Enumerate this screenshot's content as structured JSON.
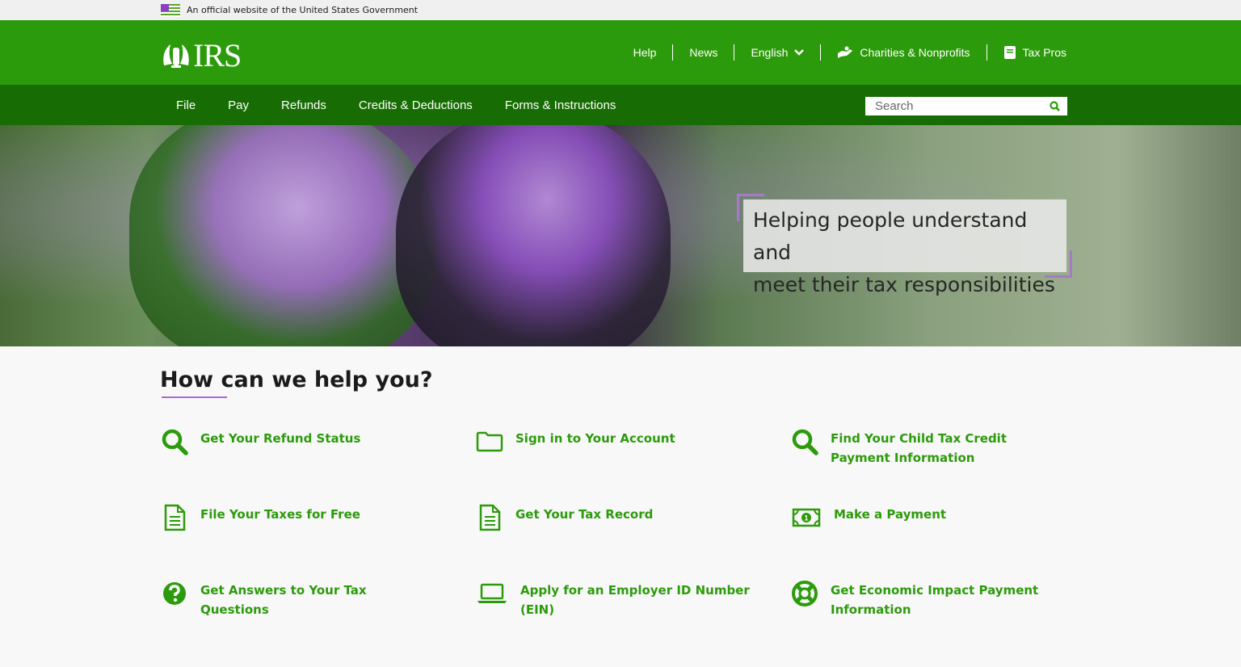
{
  "gov_banner": {
    "text": "An official website of the United States Government"
  },
  "header": {
    "logo_text": "IRS",
    "utility": [
      {
        "label": "Help"
      },
      {
        "label": "News"
      },
      {
        "label": "English"
      },
      {
        "label": "Charities & Nonprofits"
      },
      {
        "label": "Tax Pros"
      }
    ]
  },
  "mainnav": {
    "items": [
      {
        "label": "File"
      },
      {
        "label": "Pay"
      },
      {
        "label": "Refunds"
      },
      {
        "label": "Credits & Deductions"
      },
      {
        "label": "Forms & Instructions"
      }
    ],
    "search_placeholder": "Search"
  },
  "hero": {
    "line1": "Helping people understand and",
    "line2": "meet their tax responsibilities"
  },
  "help": {
    "title": "How can we help you?",
    "tiles": [
      {
        "label": "Get Your Refund Status",
        "icon": "search-icon"
      },
      {
        "label": "Sign in to Your Account",
        "icon": "folder-icon"
      },
      {
        "label": "Find Your Child Tax Credit Payment Information",
        "icon": "search-icon"
      },
      {
        "label": "File Your Taxes for Free",
        "icon": "document-icon"
      },
      {
        "label": "Get Your Tax Record",
        "icon": "document-icon"
      },
      {
        "label": "Make a Payment",
        "icon": "money-icon"
      },
      {
        "label": "Get Answers to Your Tax Questions",
        "icon": "question-icon"
      },
      {
        "label": "Apply for an Employer ID Number (EIN)",
        "icon": "laptop-icon"
      },
      {
        "label": "Get Economic Impact Payment Information",
        "icon": "lifebuoy-icon"
      }
    ]
  },
  "colors": {
    "brand_green": "#2c9b0b",
    "nav_green": "#176d03",
    "accent_purple": "#a76ad3"
  }
}
